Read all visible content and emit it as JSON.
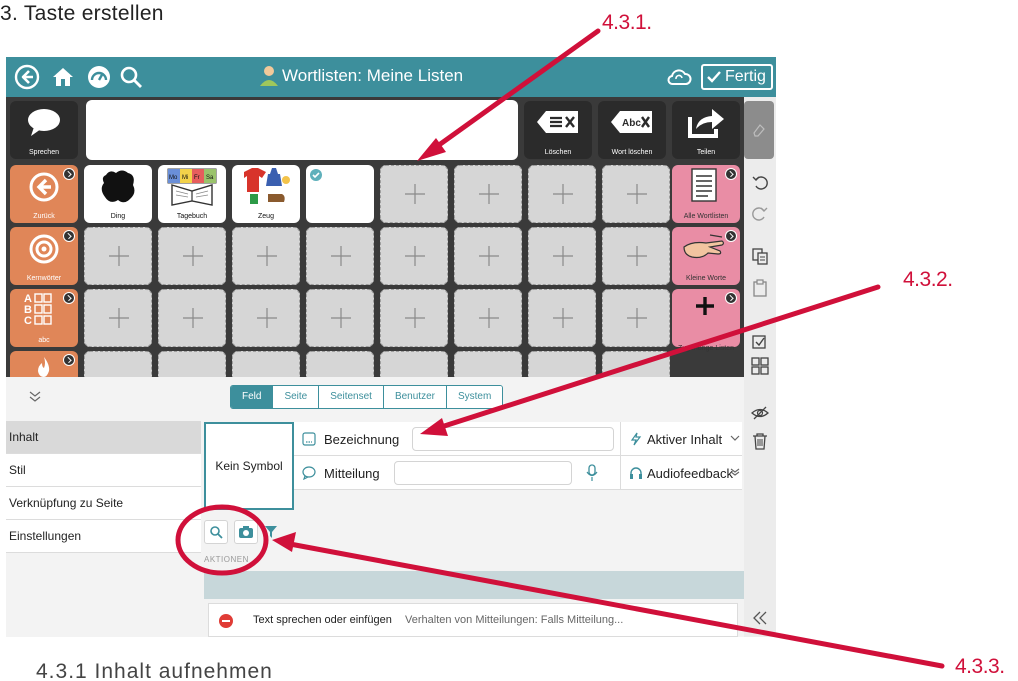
{
  "document": {
    "heading": "3.  Taste erstellen",
    "footer": "4.3.1  Inhalt aufnehmen",
    "callouts": {
      "first": "4.3.1.",
      "second": "4.3.2.",
      "third": "4.3.3."
    },
    "accent_color": "#d0103a"
  },
  "app": {
    "title": "Wortlisten: Meine Listen",
    "done_label": "Fertig",
    "theme_color": "#3d8f9c",
    "top_icons": [
      "back-circle-icon",
      "home-icon",
      "dashboard-icon",
      "search-icon",
      "cloud-sync-icon"
    ],
    "message_bar": {
      "speak_label": "Sprechen",
      "clear_label": "Löschen",
      "delete_word_label": "Wort löschen",
      "share_label": "Teilen"
    },
    "nav_buttons": [
      "Zurück",
      "Kernwörter",
      "abc",
      ""
    ],
    "symbol_cells": [
      "Ding",
      "Tagebuch",
      "Zeug",
      ""
    ],
    "calendar_days": [
      "Mo",
      "Mi",
      "Fr",
      "Sa"
    ],
    "pink_buttons": [
      "Alle Wortlisten",
      "Kleine Worte",
      "Zugehörige Listen"
    ]
  },
  "panel": {
    "tabs": [
      "Feld",
      "Seite",
      "Seitenset",
      "Benutzer",
      "System"
    ],
    "active_tab": "Feld",
    "side_menu": [
      "Inhalt",
      "Stil",
      "Verknüpfung zu Seite",
      "Einstellungen"
    ],
    "active_menu": "Inhalt",
    "symbol_placeholder": "Kein Symbol",
    "label_field": {
      "label": "Bezeichnung",
      "value": ""
    },
    "message_field": {
      "label": "Mitteilung",
      "value": ""
    },
    "active_content": "Aktiver Inhalt",
    "audio_feedback": "Audiofeedback",
    "section_heading": "AKTIONEN",
    "behaviour": {
      "action": "Text sprechen oder einfügen",
      "description": "Verhalten von Mitteilungen: Falls Mitteilung..."
    }
  }
}
